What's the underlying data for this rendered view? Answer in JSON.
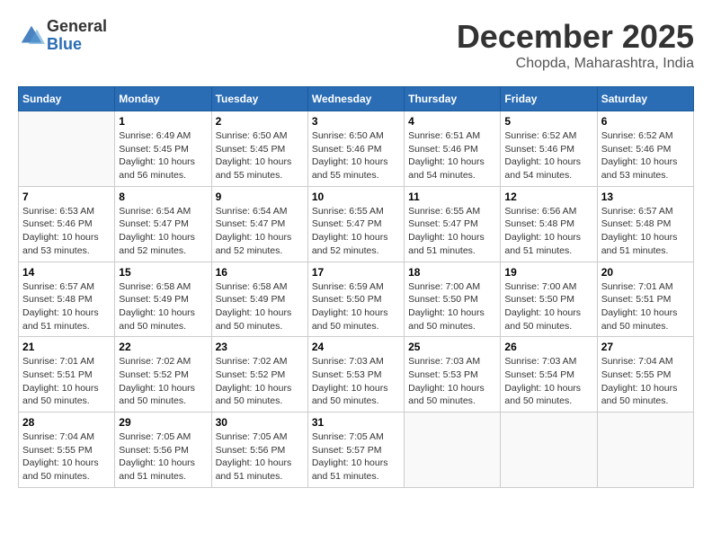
{
  "header": {
    "logo_general": "General",
    "logo_blue": "Blue",
    "month_title": "December 2025",
    "location": "Chopda, Maharashtra, India"
  },
  "days_of_week": [
    "Sunday",
    "Monday",
    "Tuesday",
    "Wednesday",
    "Thursday",
    "Friday",
    "Saturday"
  ],
  "weeks": [
    [
      {
        "day": "",
        "info": ""
      },
      {
        "day": "1",
        "info": "Sunrise: 6:49 AM\nSunset: 5:45 PM\nDaylight: 10 hours\nand 56 minutes."
      },
      {
        "day": "2",
        "info": "Sunrise: 6:50 AM\nSunset: 5:45 PM\nDaylight: 10 hours\nand 55 minutes."
      },
      {
        "day": "3",
        "info": "Sunrise: 6:50 AM\nSunset: 5:46 PM\nDaylight: 10 hours\nand 55 minutes."
      },
      {
        "day": "4",
        "info": "Sunrise: 6:51 AM\nSunset: 5:46 PM\nDaylight: 10 hours\nand 54 minutes."
      },
      {
        "day": "5",
        "info": "Sunrise: 6:52 AM\nSunset: 5:46 PM\nDaylight: 10 hours\nand 54 minutes."
      },
      {
        "day": "6",
        "info": "Sunrise: 6:52 AM\nSunset: 5:46 PM\nDaylight: 10 hours\nand 53 minutes."
      }
    ],
    [
      {
        "day": "7",
        "info": "Sunrise: 6:53 AM\nSunset: 5:46 PM\nDaylight: 10 hours\nand 53 minutes."
      },
      {
        "day": "8",
        "info": "Sunrise: 6:54 AM\nSunset: 5:47 PM\nDaylight: 10 hours\nand 52 minutes."
      },
      {
        "day": "9",
        "info": "Sunrise: 6:54 AM\nSunset: 5:47 PM\nDaylight: 10 hours\nand 52 minutes."
      },
      {
        "day": "10",
        "info": "Sunrise: 6:55 AM\nSunset: 5:47 PM\nDaylight: 10 hours\nand 52 minutes."
      },
      {
        "day": "11",
        "info": "Sunrise: 6:55 AM\nSunset: 5:47 PM\nDaylight: 10 hours\nand 51 minutes."
      },
      {
        "day": "12",
        "info": "Sunrise: 6:56 AM\nSunset: 5:48 PM\nDaylight: 10 hours\nand 51 minutes."
      },
      {
        "day": "13",
        "info": "Sunrise: 6:57 AM\nSunset: 5:48 PM\nDaylight: 10 hours\nand 51 minutes."
      }
    ],
    [
      {
        "day": "14",
        "info": "Sunrise: 6:57 AM\nSunset: 5:48 PM\nDaylight: 10 hours\nand 51 minutes."
      },
      {
        "day": "15",
        "info": "Sunrise: 6:58 AM\nSunset: 5:49 PM\nDaylight: 10 hours\nand 50 minutes."
      },
      {
        "day": "16",
        "info": "Sunrise: 6:58 AM\nSunset: 5:49 PM\nDaylight: 10 hours\nand 50 minutes."
      },
      {
        "day": "17",
        "info": "Sunrise: 6:59 AM\nSunset: 5:50 PM\nDaylight: 10 hours\nand 50 minutes."
      },
      {
        "day": "18",
        "info": "Sunrise: 7:00 AM\nSunset: 5:50 PM\nDaylight: 10 hours\nand 50 minutes."
      },
      {
        "day": "19",
        "info": "Sunrise: 7:00 AM\nSunset: 5:50 PM\nDaylight: 10 hours\nand 50 minutes."
      },
      {
        "day": "20",
        "info": "Sunrise: 7:01 AM\nSunset: 5:51 PM\nDaylight: 10 hours\nand 50 minutes."
      }
    ],
    [
      {
        "day": "21",
        "info": "Sunrise: 7:01 AM\nSunset: 5:51 PM\nDaylight: 10 hours\nand 50 minutes."
      },
      {
        "day": "22",
        "info": "Sunrise: 7:02 AM\nSunset: 5:52 PM\nDaylight: 10 hours\nand 50 minutes."
      },
      {
        "day": "23",
        "info": "Sunrise: 7:02 AM\nSunset: 5:52 PM\nDaylight: 10 hours\nand 50 minutes."
      },
      {
        "day": "24",
        "info": "Sunrise: 7:03 AM\nSunset: 5:53 PM\nDaylight: 10 hours\nand 50 minutes."
      },
      {
        "day": "25",
        "info": "Sunrise: 7:03 AM\nSunset: 5:53 PM\nDaylight: 10 hours\nand 50 minutes."
      },
      {
        "day": "26",
        "info": "Sunrise: 7:03 AM\nSunset: 5:54 PM\nDaylight: 10 hours\nand 50 minutes."
      },
      {
        "day": "27",
        "info": "Sunrise: 7:04 AM\nSunset: 5:55 PM\nDaylight: 10 hours\nand 50 minutes."
      }
    ],
    [
      {
        "day": "28",
        "info": "Sunrise: 7:04 AM\nSunset: 5:55 PM\nDaylight: 10 hours\nand 50 minutes."
      },
      {
        "day": "29",
        "info": "Sunrise: 7:05 AM\nSunset: 5:56 PM\nDaylight: 10 hours\nand 51 minutes."
      },
      {
        "day": "30",
        "info": "Sunrise: 7:05 AM\nSunset: 5:56 PM\nDaylight: 10 hours\nand 51 minutes."
      },
      {
        "day": "31",
        "info": "Sunrise: 7:05 AM\nSunset: 5:57 PM\nDaylight: 10 hours\nand 51 minutes."
      },
      {
        "day": "",
        "info": ""
      },
      {
        "day": "",
        "info": ""
      },
      {
        "day": "",
        "info": ""
      }
    ]
  ]
}
